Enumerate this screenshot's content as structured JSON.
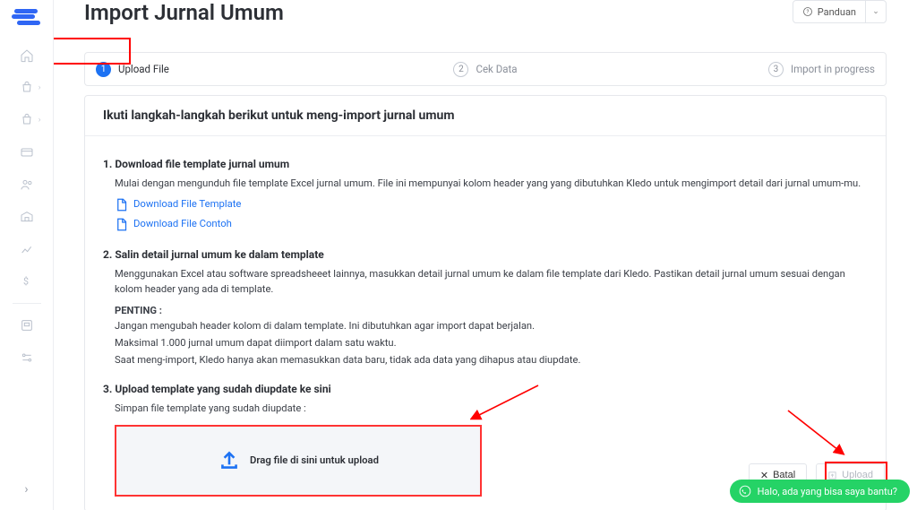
{
  "page_title": "Import Jurnal Umum",
  "panduan_label": "Panduan",
  "steps": {
    "s1": {
      "num": "1",
      "label": "Upload File"
    },
    "s2": {
      "num": "2",
      "label": "Cek Data"
    },
    "s3": {
      "num": "3",
      "label": "Import in progress"
    }
  },
  "card": {
    "heading": "Ikuti langkah-langkah berikut untuk meng-import jurnal umum",
    "sec1_head": "1. Download file template jurnal umum",
    "sec1_para": "Mulai dengan mengunduh file template Excel jurnal umum. File ini mempunyai kolom header yang yang dibutuhkan Kledo untuk mengimport detail dari jurnal umum-mu.",
    "dl_template": "Download File Template",
    "dl_contoh": "Download File Contoh",
    "sec2_head": "2. Salin detail jurnal umum ke dalam template",
    "sec2_para": "Menggunakan Excel atau software spreadsheeet lainnya, masukkan detail jurnal umum ke dalam file template dari Kledo. Pastikan detail jurnal umum sesuai dengan kolom header yang ada di template.",
    "penting_label": "PENTING :",
    "penting_l1": "Jangan mengubah header kolom di dalam template. Ini dibutuhkan agar import dapat berjalan.",
    "penting_l2": "Maksimal 1.000 jurnal umum dapat diimport dalam satu waktu.",
    "penting_l3": "Saat meng-import, Kledo hanya akan memasukkan data baru, tidak ada data yang dihapus atau diupdate.",
    "sec3_head": "3. Upload template yang sudah diupdate ke sini",
    "sec3_para": "Simpan file template yang sudah diupdate :",
    "dropzone_text": "Drag file di sini untuk upload"
  },
  "buttons": {
    "batal": "Batal",
    "upload": "Upload"
  },
  "wa_text": "Halo, ada yang bisa saya bantu?"
}
